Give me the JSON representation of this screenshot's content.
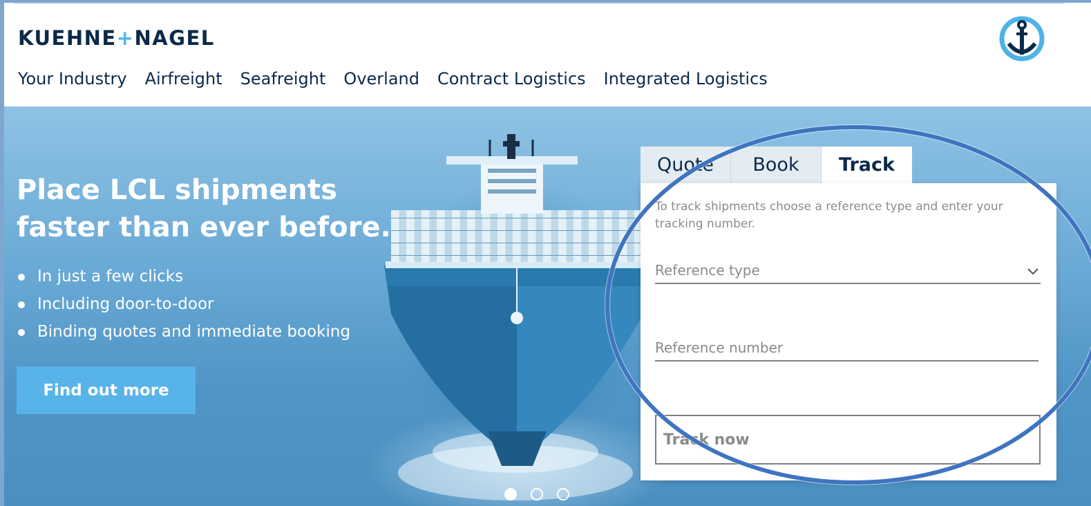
{
  "header": {
    "logo_left": "KUEHNE",
    "logo_plus": "+",
    "logo_right": "NAGEL",
    "nav": [
      "Your Industry",
      "Airfreight",
      "Seafreight",
      "Overland",
      "Contract Logistics",
      "Integrated Logistics"
    ],
    "icon": "anchor-icon"
  },
  "hero": {
    "headline_line1": "Place LCL shipments",
    "headline_line2": "faster than ever before.",
    "bullets": [
      "In just a few clicks",
      "Including door-to-door",
      "Binding quotes and immediate booking"
    ],
    "cta_label": "Find out more",
    "carousel": {
      "count": 3,
      "active": 1
    }
  },
  "panel": {
    "tabs": [
      "Quote",
      "Book",
      "Track"
    ],
    "active_tab": "Track",
    "intro": "To track shipments choose a reference type and enter your tracking number.",
    "reference_type_placeholder": "Reference type",
    "reference_number_placeholder": "Reference number",
    "track_button": "Track now"
  },
  "colors": {
    "brand_navy": "#0b2a4a",
    "brand_light_blue": "#4fb3e6",
    "cta_blue": "#58b3e8",
    "highlight_ring": "#3f74c0"
  }
}
